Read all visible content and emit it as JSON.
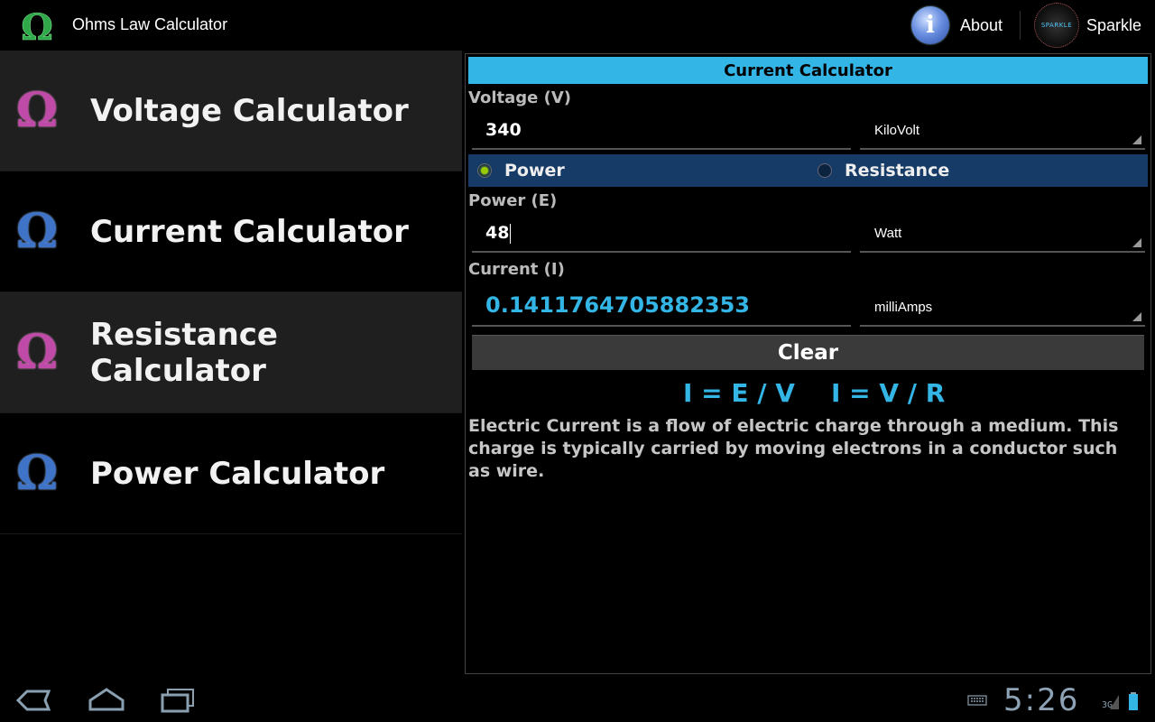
{
  "app": {
    "title": "Ohms Law Calculator"
  },
  "actionbar": {
    "about_label": "About",
    "sparkle_label": "Sparkle",
    "sparkle_logo_text": "SPARKLE"
  },
  "sidebar": {
    "items": [
      {
        "label": "Voltage Calculator",
        "icon": "omega-icon",
        "color": "#c04aa8"
      },
      {
        "label": "Current Calculator",
        "icon": "omega-icon",
        "color": "#3f73c8"
      },
      {
        "label": "Resistance Calculator",
        "icon": "omega-icon",
        "color": "#c04aa8"
      },
      {
        "label": "Power Calculator",
        "icon": "omega-icon",
        "color": "#3f73c8"
      }
    ]
  },
  "panel": {
    "title": "Current Calculator",
    "voltage": {
      "label": "Voltage (V)",
      "value": "340",
      "unit": "KiloVolt"
    },
    "mode": {
      "options": [
        "Power",
        "Resistance"
      ],
      "selected": "Power"
    },
    "power": {
      "label": "Power (E)",
      "value": "48",
      "unit": "Watt"
    },
    "current": {
      "label": "Current (I)",
      "value": "0.1411764705882353",
      "unit": "milliAmps"
    },
    "clear_label": "Clear",
    "formulas": [
      "I = E / V",
      "I = V / R"
    ],
    "description": "Electric Current is a flow of electric charge through a medium. This charge is typically carried by moving electrons in a conductor such as wire."
  },
  "system": {
    "time": "5:26",
    "network": "3G"
  },
  "colors": {
    "accent": "#33b5e5",
    "radio_bg": "#163b66"
  }
}
